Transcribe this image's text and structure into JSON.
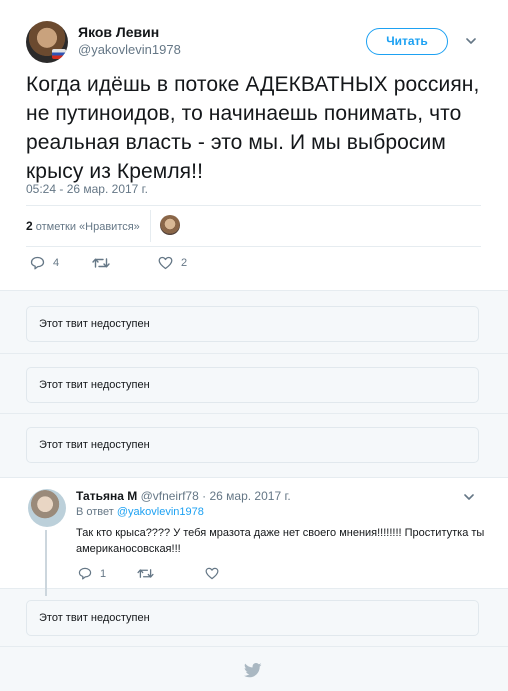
{
  "main_tweet": {
    "author_name": "Яков Левин",
    "author_handle": "@yakovlevin1978",
    "follow_label": "Читать",
    "text": "Когда идёшь в потоке АДЕКВАТНЫХ россиян, не путиноидов, то начинаешь понимать, что реальная власть - это мы. И мы выбросим крысу из Кремля!!",
    "timestamp": "05:24 - 26 мар. 2017 г.",
    "likes_number": "2",
    "likes_label": "отметки «Нравится»",
    "reply_count": "4",
    "retweet_count": "",
    "like_count": "2"
  },
  "unavailable_label": "Этот твит недоступен",
  "reply": {
    "author_name": "Татьяна М",
    "author_handle": "@vfneirf78",
    "separator": "·",
    "date": "26 мар. 2017 г.",
    "in_reply_prefix": "В ответ",
    "in_reply_mention": "@yakovlevin1978",
    "text": "Так кто крыса???? У тебя мразота даже нет своего мнения!!!!!!!! Проститутка ты американосовская!!!",
    "reply_count": "1",
    "retweet_count": "",
    "like_count": ""
  },
  "colors": {
    "accent": "#1da1f2",
    "muted": "#657786",
    "text": "#14171a",
    "border": "#e6ecf0",
    "background_gray": "#f5f8fa"
  },
  "icons": [
    "reply-icon",
    "retweet-icon",
    "heart-icon",
    "chevron-down-icon",
    "twitter-bird-icon"
  ]
}
